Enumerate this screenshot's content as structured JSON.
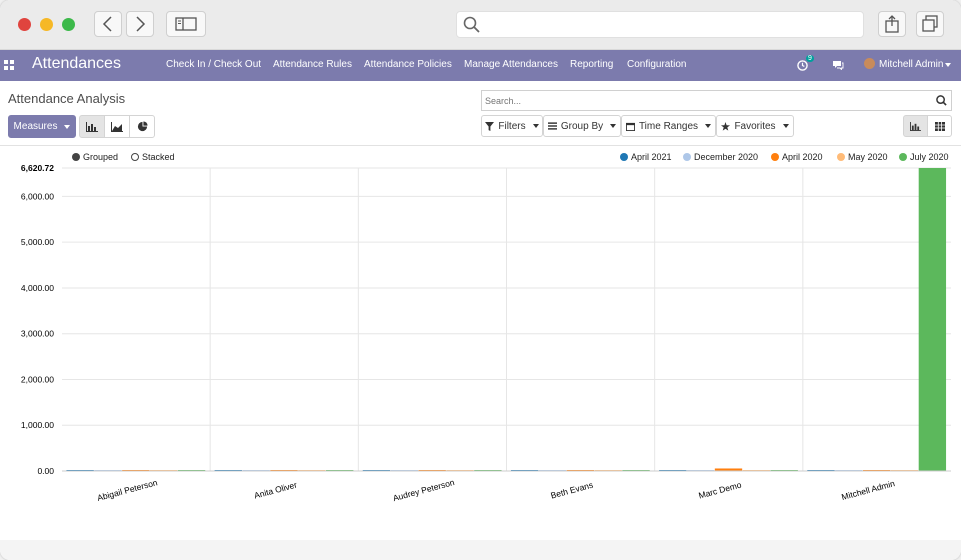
{
  "app": {
    "title": "Attendances",
    "menu": [
      "Check In / Check Out",
      "Attendance Rules",
      "Attendance Policies",
      "Manage Attendances",
      "Reporting",
      "Configuration"
    ],
    "activity_badge": "9",
    "user_name": "Mitchell Admin"
  },
  "page": {
    "title": "Attendance Analysis",
    "search_placeholder": "Search...",
    "measures_label": "Measures",
    "filters_label": "Filters",
    "group_by_label": "Group By",
    "time_ranges_label": "Time Ranges",
    "favorites_label": "Favorites"
  },
  "legend_mode": {
    "grouped": "Grouped",
    "stacked": "Stacked"
  },
  "colors": {
    "brand": "#7c7bad",
    "April 2021": "#1f77b4",
    "December 2020": "#aec7e8",
    "April 2020": "#ff7f0e",
    "May 2020": "#ffbb78",
    "July 2020": "#5cb85c"
  },
  "chart_data": {
    "type": "bar",
    "categories": [
      "Abigail Peterson",
      "Anita Oliver",
      "Audrey Peterson",
      "Beth Evans",
      "Marc Demo",
      "Mitchell Admin"
    ],
    "series": [
      {
        "name": "April 2021",
        "values": [
          3,
          2,
          2,
          3,
          2,
          3
        ]
      },
      {
        "name": "December 2020",
        "values": [
          2,
          2,
          2,
          2,
          2,
          2
        ]
      },
      {
        "name": "April 2020",
        "values": [
          4,
          3,
          3,
          3,
          55,
          3
        ]
      },
      {
        "name": "May 2020",
        "values": [
          3,
          3,
          3,
          3,
          3,
          3
        ]
      },
      {
        "name": "July 2020",
        "values": [
          3,
          3,
          3,
          3,
          3,
          6620.72
        ]
      }
    ],
    "ylim": [
      0,
      6620.72
    ],
    "yticks": [
      "0.00",
      "1,000.00",
      "2,000.00",
      "3,000.00",
      "4,000.00",
      "5,000.00",
      "6,000.00",
      "6,620.72"
    ],
    "ytick_values": [
      0,
      1000,
      2000,
      3000,
      4000,
      5000,
      6000,
      6620.72
    ],
    "legend_position": "top-right",
    "grid": true
  }
}
